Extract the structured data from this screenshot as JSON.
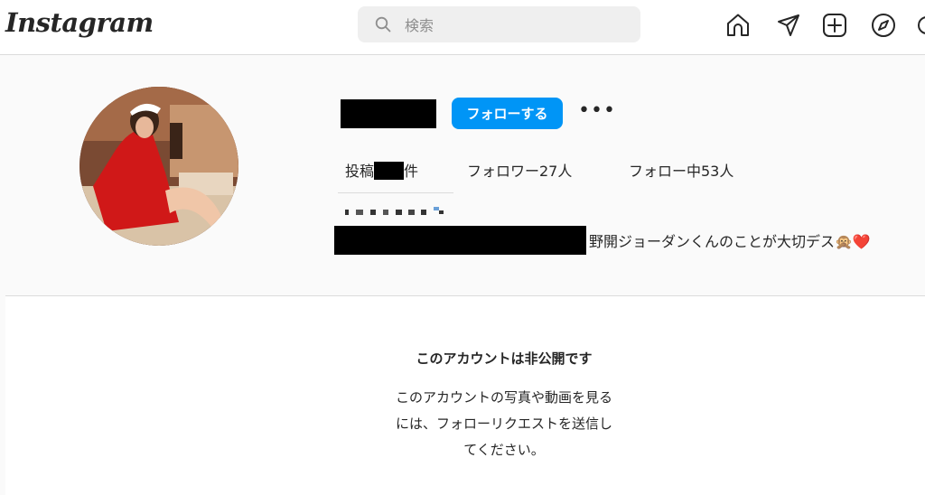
{
  "nav": {
    "logo_text": "Instagram",
    "search_placeholder": "検索",
    "icons": [
      "home-icon",
      "send-icon",
      "new-post-icon",
      "explore-icon"
    ]
  },
  "profile": {
    "follow_label": "フォローする",
    "more_label": "•••",
    "posts_prefix": "投稿",
    "posts_suffix": "件",
    "followers_label": "フォロワー27人",
    "following_label": "フォロー中53人",
    "bio_text": "野開ジョーダンくんのことが大切デス🙊❤️"
  },
  "private": {
    "title": "このアカウントは非公開です",
    "desc_lines": [
      "このアカウントの写真や動画を見る",
      "には、フォローリクエストを送信し",
      "てください。"
    ]
  },
  "colors": {
    "accent": "#0095f6",
    "background": "#fafafa",
    "border": "#dbdbdb"
  }
}
